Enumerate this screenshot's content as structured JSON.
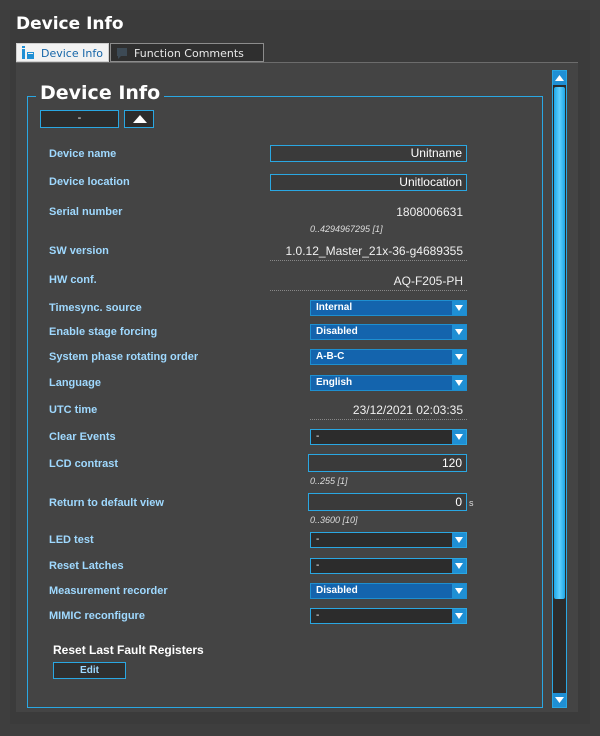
{
  "window": {
    "title": "Device Info"
  },
  "tabs": [
    {
      "label": "Device Info",
      "icon": "device-info-icon",
      "active": true
    },
    {
      "label": "Function Comments",
      "icon": "comment-icon",
      "active": false
    }
  ],
  "group": {
    "title": "Device Info",
    "collapse_label": "-"
  },
  "fields": {
    "device_name": {
      "label": "Device name",
      "value": "Unitname"
    },
    "device_location": {
      "label": "Device location",
      "value": "Unitlocation"
    },
    "serial_number": {
      "label": "Serial number",
      "value": "1808006631",
      "range": "0..4294967295 [1]"
    },
    "sw_version": {
      "label": "SW version",
      "value": "1.0.12_Master_21x-36-g4689355"
    },
    "hw_conf": {
      "label": "HW conf.",
      "value": "AQ-F205-PH"
    },
    "timesync_source": {
      "label": "Timesync. source",
      "value": "Internal"
    },
    "enable_stage_forcing": {
      "label": "Enable stage forcing",
      "value": "Disabled"
    },
    "phase_rotating_order": {
      "label": "System phase rotating order",
      "value": "A-B-C"
    },
    "language": {
      "label": "Language",
      "value": "English"
    },
    "utc_time": {
      "label": "UTC time",
      "value": "23/12/2021 02:03:35"
    },
    "clear_events": {
      "label": "Clear Events",
      "value": "-"
    },
    "lcd_contrast": {
      "label": "LCD contrast",
      "value": "120",
      "range": "0..255 [1]"
    },
    "return_default_view": {
      "label": "Return to default view",
      "value": "0",
      "unit": "s",
      "range": "0..3600 [10]"
    },
    "led_test": {
      "label": "LED test",
      "value": "-"
    },
    "reset_latches": {
      "label": "Reset Latches",
      "value": "-"
    },
    "measurement_recorder": {
      "label": "Measurement recorder",
      "value": "Disabled"
    },
    "mimic_reconfigure": {
      "label": "MIMIC reconfigure",
      "value": "-"
    }
  },
  "reset_section": {
    "title": "Reset Last Fault Registers",
    "button_label": "Edit"
  },
  "colors": {
    "accent": "#2aa7e2",
    "label": "#9fd9ff",
    "select_fill": "#1464ad"
  }
}
